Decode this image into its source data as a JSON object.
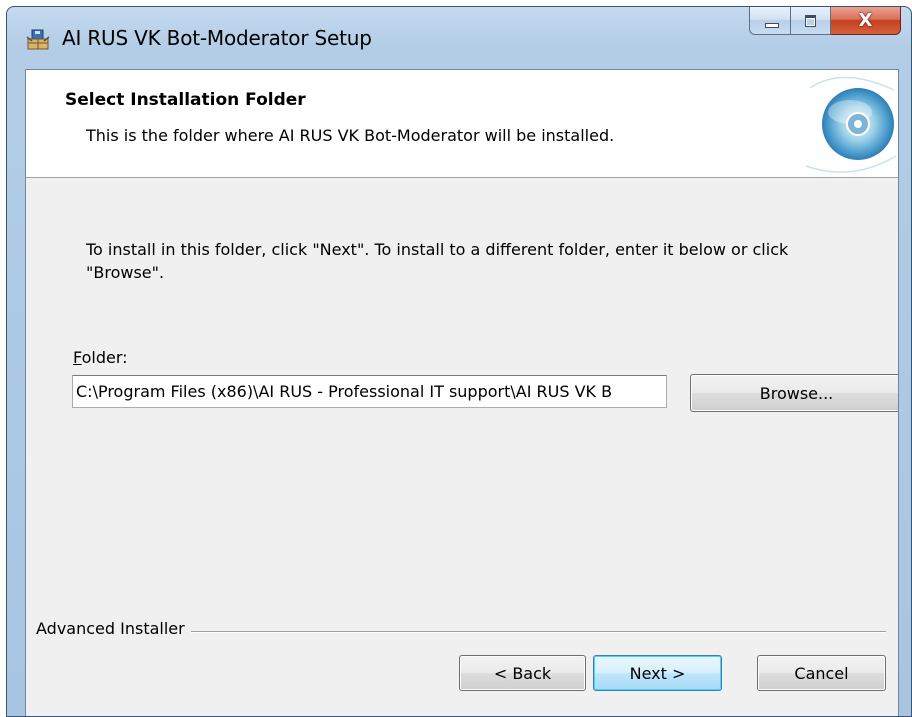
{
  "window": {
    "title": "AI RUS VK Bot-Moderator Setup",
    "close_glyph": "X"
  },
  "banner": {
    "title": "Select Installation Folder",
    "subtitle": "This is the folder where AI RUS VK Bot-Moderator will be installed."
  },
  "body": {
    "instructions": "To install in this folder, click \"Next\". To install to a different folder, enter it below or click \"Browse\".",
    "folder_label_accel": "F",
    "folder_label_rest": "older:",
    "folder_value": "C:\\Program Files (x86)\\AI RUS - Professional IT support\\AI RUS VK B",
    "browse_label": "Browse..."
  },
  "footer": {
    "brand": "Advanced Installer",
    "back_label": "< Back",
    "next_label": "Next >",
    "cancel_label": "Cancel"
  },
  "icons": {
    "app": "installer-package-icon",
    "banner": "disc-icon"
  }
}
